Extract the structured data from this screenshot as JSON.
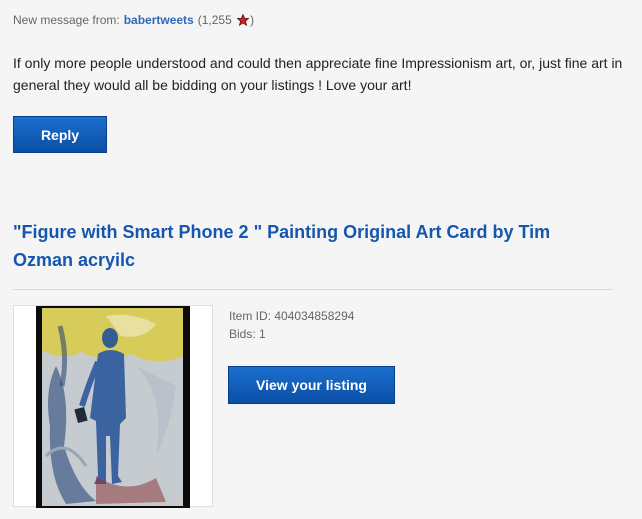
{
  "message": {
    "header_prefix": "New message from:",
    "sender": "babertweets",
    "score_open": "(1,255",
    "score_close": ")",
    "body": "If only more people understood and could then appreciate fine Impressionism art, or, just fine art in general they would all be bidding on your listings ! Love your art!",
    "reply_label": "Reply"
  },
  "listing": {
    "title": "\"Figure with Smart Phone 2 \" Painting Original Art Card by Tim Ozman acryilc",
    "item_id": "Item ID: 404034858294",
    "bids": "Bids: 1",
    "view_label": "View your listing"
  },
  "colors": {
    "accent": "#0a4fa6",
    "link": "#1556b0",
    "star": "#d62020"
  }
}
